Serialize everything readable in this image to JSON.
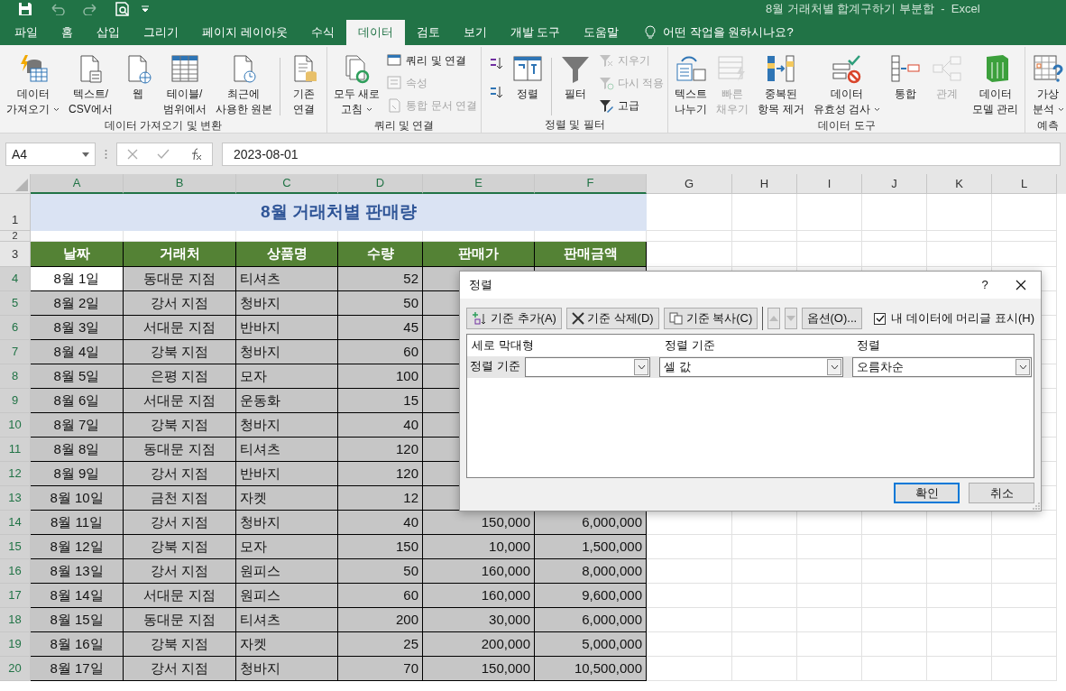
{
  "title_bar": {
    "title": "8월 거래처별 합계구하기 부분합  -  Excel"
  },
  "tabs": [
    {
      "label": "파일",
      "selected": false
    },
    {
      "label": "홈",
      "selected": false
    },
    {
      "label": "삽입",
      "selected": false
    },
    {
      "label": "그리기",
      "selected": false
    },
    {
      "label": "페이지 레이아웃",
      "selected": false
    },
    {
      "label": "수식",
      "selected": false
    },
    {
      "label": "데이터",
      "selected": true
    },
    {
      "label": "검토",
      "selected": false
    },
    {
      "label": "보기",
      "selected": false
    },
    {
      "label": "개발 도구",
      "selected": false
    },
    {
      "label": "도움말",
      "selected": false
    }
  ],
  "tell_me": "어떤 작업을 원하시나요?",
  "ribbon": [
    {
      "label": "데이터 가져오기 및 변환",
      "items": [
        {
          "kind": "large",
          "lines": [
            "데이터",
            "가져오기"
          ],
          "dropdown": true,
          "disabled": false
        },
        {
          "kind": "large",
          "lines": [
            "텍스트/",
            "CSV에서"
          ],
          "dropdown": false,
          "disabled": false
        },
        {
          "kind": "large",
          "lines": [
            "웹"
          ],
          "dropdown": false,
          "disabled": false
        },
        {
          "kind": "large",
          "lines": [
            "테이블/",
            "범위에서"
          ],
          "dropdown": false,
          "disabled": false
        },
        {
          "kind": "large",
          "lines": [
            "최근에",
            "사용한 원본"
          ],
          "dropdown": false,
          "disabled": false
        },
        {
          "kind": "large",
          "lines": [
            "기존",
            "연결"
          ],
          "dropdown": false,
          "disabled": false,
          "separated": true
        }
      ]
    },
    {
      "label": "쿼리 및 연결",
      "items": [
        {
          "kind": "large",
          "lines": [
            "모두 새로",
            "고침"
          ],
          "dropdown": true,
          "disabled": false
        },
        {
          "kind": "small",
          "label": "쿼리 및 연결",
          "disabled": false
        },
        {
          "kind": "small",
          "label": "속성",
          "disabled": true
        },
        {
          "kind": "small",
          "label": "통합 문서 연결",
          "disabled": true
        }
      ]
    },
    {
      "label": "정렬 및 필터",
      "items": [
        {
          "kind": "icon",
          "disabled": false
        },
        {
          "kind": "icon",
          "disabled": false
        },
        {
          "kind": "large",
          "lines": [
            "정렬"
          ],
          "dropdown": false,
          "disabled": false
        },
        {
          "kind": "large",
          "lines": [
            "필터"
          ],
          "dropdown": false,
          "disabled": false,
          "separated": true
        },
        {
          "kind": "small",
          "label": "지우기",
          "disabled": true
        },
        {
          "kind": "small",
          "label": "다시 적용",
          "disabled": true
        },
        {
          "kind": "small",
          "label": "고급",
          "disabled": false
        }
      ]
    },
    {
      "label": "데이터 도구",
      "items": [
        {
          "kind": "large",
          "lines": [
            "텍스트",
            "나누기"
          ],
          "dropdown": false,
          "disabled": false
        },
        {
          "kind": "large",
          "lines": [
            "빠른",
            "채우기"
          ],
          "dropdown": false,
          "disabled": true
        },
        {
          "kind": "large",
          "lines": [
            "중복된",
            "항목 제거"
          ],
          "dropdown": false,
          "disabled": false
        },
        {
          "kind": "large",
          "lines": [
            "데이터",
            "유효성 검사"
          ],
          "dropdown": true,
          "disabled": false
        },
        {
          "kind": "large",
          "lines": [
            "통합"
          ],
          "dropdown": false,
          "disabled": false
        },
        {
          "kind": "large",
          "lines": [
            "관계"
          ],
          "dropdown": false,
          "disabled": true
        },
        {
          "kind": "large",
          "lines": [
            "데이터",
            "모델 관리"
          ],
          "dropdown": false,
          "disabled": false
        }
      ]
    },
    {
      "label": "예측",
      "items": [
        {
          "kind": "large",
          "lines": [
            "가상",
            "분석"
          ],
          "dropdown": true,
          "disabled": false
        }
      ]
    }
  ],
  "formula_bar": {
    "name_box": "A4",
    "formula": "2023-08-01"
  },
  "sheet": {
    "columns": [
      {
        "label": "A",
        "selected": true
      },
      {
        "label": "B",
        "selected": true
      },
      {
        "label": "C",
        "selected": true
      },
      {
        "label": "D",
        "selected": true
      },
      {
        "label": "E",
        "selected": true
      },
      {
        "label": "F",
        "selected": true
      },
      {
        "label": "G",
        "selected": false
      },
      {
        "label": "H",
        "selected": false
      },
      {
        "label": "I",
        "selected": false
      },
      {
        "label": "J",
        "selected": false
      },
      {
        "label": "K",
        "selected": false
      },
      {
        "label": "L",
        "selected": false
      }
    ],
    "title": {
      "row": "1",
      "text": "8월 거래처별 판매량"
    },
    "blank_row": {
      "row": "2"
    },
    "header": {
      "row": "3",
      "cells": [
        "날짜",
        "거래처",
        "상품명",
        "수량",
        "판매가",
        "판매금액"
      ]
    },
    "rows": [
      {
        "row": "4",
        "selected": true,
        "active": true,
        "cells": [
          "8월 1일",
          "동대문 지점",
          "티셔츠",
          "52"
        ]
      },
      {
        "row": "5",
        "selected": true,
        "active": false,
        "cells": [
          "8월 2일",
          "강서 지점",
          "청바지",
          "50"
        ]
      },
      {
        "row": "6",
        "selected": true,
        "active": false,
        "cells": [
          "8월 3일",
          "서대문 지점",
          "반바지",
          "45"
        ]
      },
      {
        "row": "7",
        "selected": true,
        "active": false,
        "cells": [
          "8월 4일",
          "강북 지점",
          "청바지",
          "60"
        ]
      },
      {
        "row": "8",
        "selected": true,
        "active": false,
        "cells": [
          "8월 5일",
          "은평 지점",
          "모자",
          "100"
        ]
      },
      {
        "row": "9",
        "selected": true,
        "active": false,
        "cells": [
          "8월 6일",
          "서대문 지점",
          "운동화",
          "15"
        ]
      },
      {
        "row": "10",
        "selected": true,
        "active": false,
        "cells": [
          "8월 7일",
          "강북 지점",
          "청바지",
          "40"
        ]
      },
      {
        "row": "11",
        "selected": true,
        "active": false,
        "cells": [
          "8월 8일",
          "동대문 지점",
          "티셔츠",
          "120"
        ]
      },
      {
        "row": "12",
        "selected": true,
        "active": false,
        "cells": [
          "8월 9일",
          "강서 지점",
          "반바지",
          "120"
        ]
      },
      {
        "row": "13",
        "selected": true,
        "active": false,
        "cells": [
          "8월 10일",
          "금천 지점",
          "자켓",
          "12"
        ]
      },
      {
        "row": "14",
        "selected": true,
        "active": false,
        "cells": [
          "8월 11일",
          "강서 지점",
          "청바지",
          "40",
          "150,000",
          "6,000,000"
        ]
      },
      {
        "row": "15",
        "selected": true,
        "active": false,
        "cells": [
          "8월 12일",
          "강북 지점",
          "모자",
          "150",
          "10,000",
          "1,500,000"
        ]
      },
      {
        "row": "16",
        "selected": true,
        "active": false,
        "cells": [
          "8월 13일",
          "강서 지점",
          "원피스",
          "50",
          "160,000",
          "8,000,000"
        ]
      },
      {
        "row": "17",
        "selected": true,
        "active": false,
        "cells": [
          "8월 14일",
          "서대문 지점",
          "원피스",
          "60",
          "160,000",
          "9,600,000"
        ]
      },
      {
        "row": "18",
        "selected": true,
        "active": false,
        "cells": [
          "8월 15일",
          "동대문 지점",
          "티셔츠",
          "200",
          "30,000",
          "6,000,000"
        ]
      },
      {
        "row": "19",
        "selected": true,
        "active": false,
        "cells": [
          "8월 16일",
          "강북 지점",
          "자켓",
          "25",
          "200,000",
          "5,000,000"
        ]
      },
      {
        "row": "20",
        "selected": true,
        "active": false,
        "cells": [
          "8월 17일",
          "강서 지점",
          "청바지",
          "70",
          "150,000",
          "10,500,000"
        ]
      }
    ]
  },
  "dialog": {
    "title": "정렬",
    "help": "?",
    "toolbar": [
      {
        "kind": "add",
        "label": "기준 추가(A)",
        "disabled": false
      },
      {
        "kind": "delete",
        "label": "기준 삭제(D)",
        "disabled": false
      },
      {
        "kind": "copy",
        "label": "기준 복사(C)",
        "disabled": false
      },
      {
        "kind": "up",
        "disabled": true
      },
      {
        "kind": "down",
        "disabled": true
      },
      {
        "kind": "text",
        "label": "옵션(O)...",
        "disabled": false
      }
    ],
    "header_checkbox": {
      "label": "내 데이터에 머리글 표시(H)",
      "checked": true
    },
    "columns": [
      "세로 막대형",
      "정렬 기준",
      "정렬"
    ],
    "levels": [
      {
        "label": "정렬 기준",
        "selected": true,
        "sort_on": "셀 값",
        "order": "오름차순"
      }
    ],
    "buttons": [
      {
        "label": "확인",
        "default": true
      },
      {
        "label": "취소",
        "default": false
      }
    ]
  }
}
